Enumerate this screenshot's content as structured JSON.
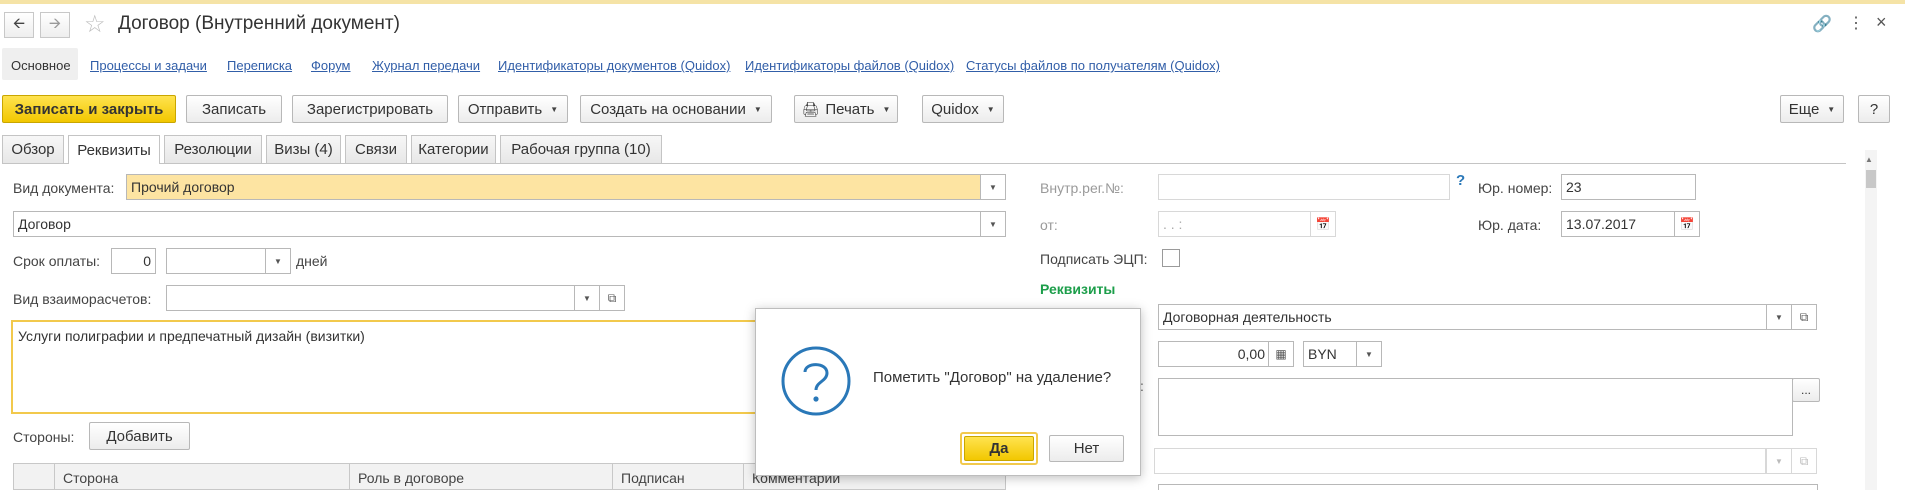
{
  "window": {
    "title": "Договор (Внутренний документ)"
  },
  "nav_links": [
    {
      "label": "Основное"
    },
    {
      "label": "Процессы и задачи"
    },
    {
      "label": "Переписка"
    },
    {
      "label": "Форум"
    },
    {
      "label": "Журнал передачи"
    },
    {
      "label": "Идентификаторы документов (Quidox)"
    },
    {
      "label": "Идентификаторы файлов (Quidox)"
    },
    {
      "label": "Статусы файлов по получателям (Quidox)"
    }
  ],
  "toolbar": {
    "save_close": "Записать и закрыть",
    "save": "Записать",
    "register": "Зарегистрировать",
    "send": "Отправить",
    "create_based": "Создать на основании",
    "print": "Печать",
    "quidox": "Quidox",
    "more": "Еще",
    "help": "?"
  },
  "tabs": [
    {
      "label": "Обзор"
    },
    {
      "label": "Реквизиты"
    },
    {
      "label": "Резолюции"
    },
    {
      "label": "Визы (4)"
    },
    {
      "label": "Связи"
    },
    {
      "label": "Категории"
    },
    {
      "label": "Рабочая группа (10)"
    }
  ],
  "left": {
    "doc_type_label": "Вид документа:",
    "doc_type_value": "Прочий договор",
    "doc_kind_value": "Договор",
    "payment_term_label": "Срок оплаты:",
    "payment_term_value": "0",
    "payment_term_unit": "дней",
    "settlement_label": "Вид взаиморасчетов:",
    "settlement_value": "",
    "description": "Услуги полиграфии и предпечатный дизайн (визитки)",
    "parties_label": "Стороны:",
    "add_button": "Добавить",
    "table_headers": [
      "Сторона",
      "Роль в договоре",
      "Подписан",
      "Комментарии"
    ]
  },
  "right": {
    "internal_reg_label": "Внутр.рег.№:",
    "internal_reg_value": "",
    "help_mark": "?",
    "legal_number_label": "Юр. номер:",
    "legal_number_value": "23",
    "from_label": "от:",
    "from_value": ". .   :",
    "legal_date_label": "Юр. дата:",
    "legal_date_value": "13.07.2017",
    "sign_ecp_label": "Подписать ЭЦП:",
    "requisites_header": "Реквизиты",
    "activity_value": "Договорная деятельность",
    "amount_value": "0,00",
    "currency_value": "BYN",
    "partial_label": ":",
    "ellipsis": "..."
  },
  "dialog": {
    "message": "Пометить \"Договор\" на удаление?",
    "yes": "Да",
    "no": "Нет",
    "icon": "question-icon"
  },
  "colors": {
    "accent_yellow": "#f2c700",
    "link_blue": "#315ea8",
    "requisites_green": "#1c9e4a",
    "icon_blue": "#2a78b8"
  }
}
